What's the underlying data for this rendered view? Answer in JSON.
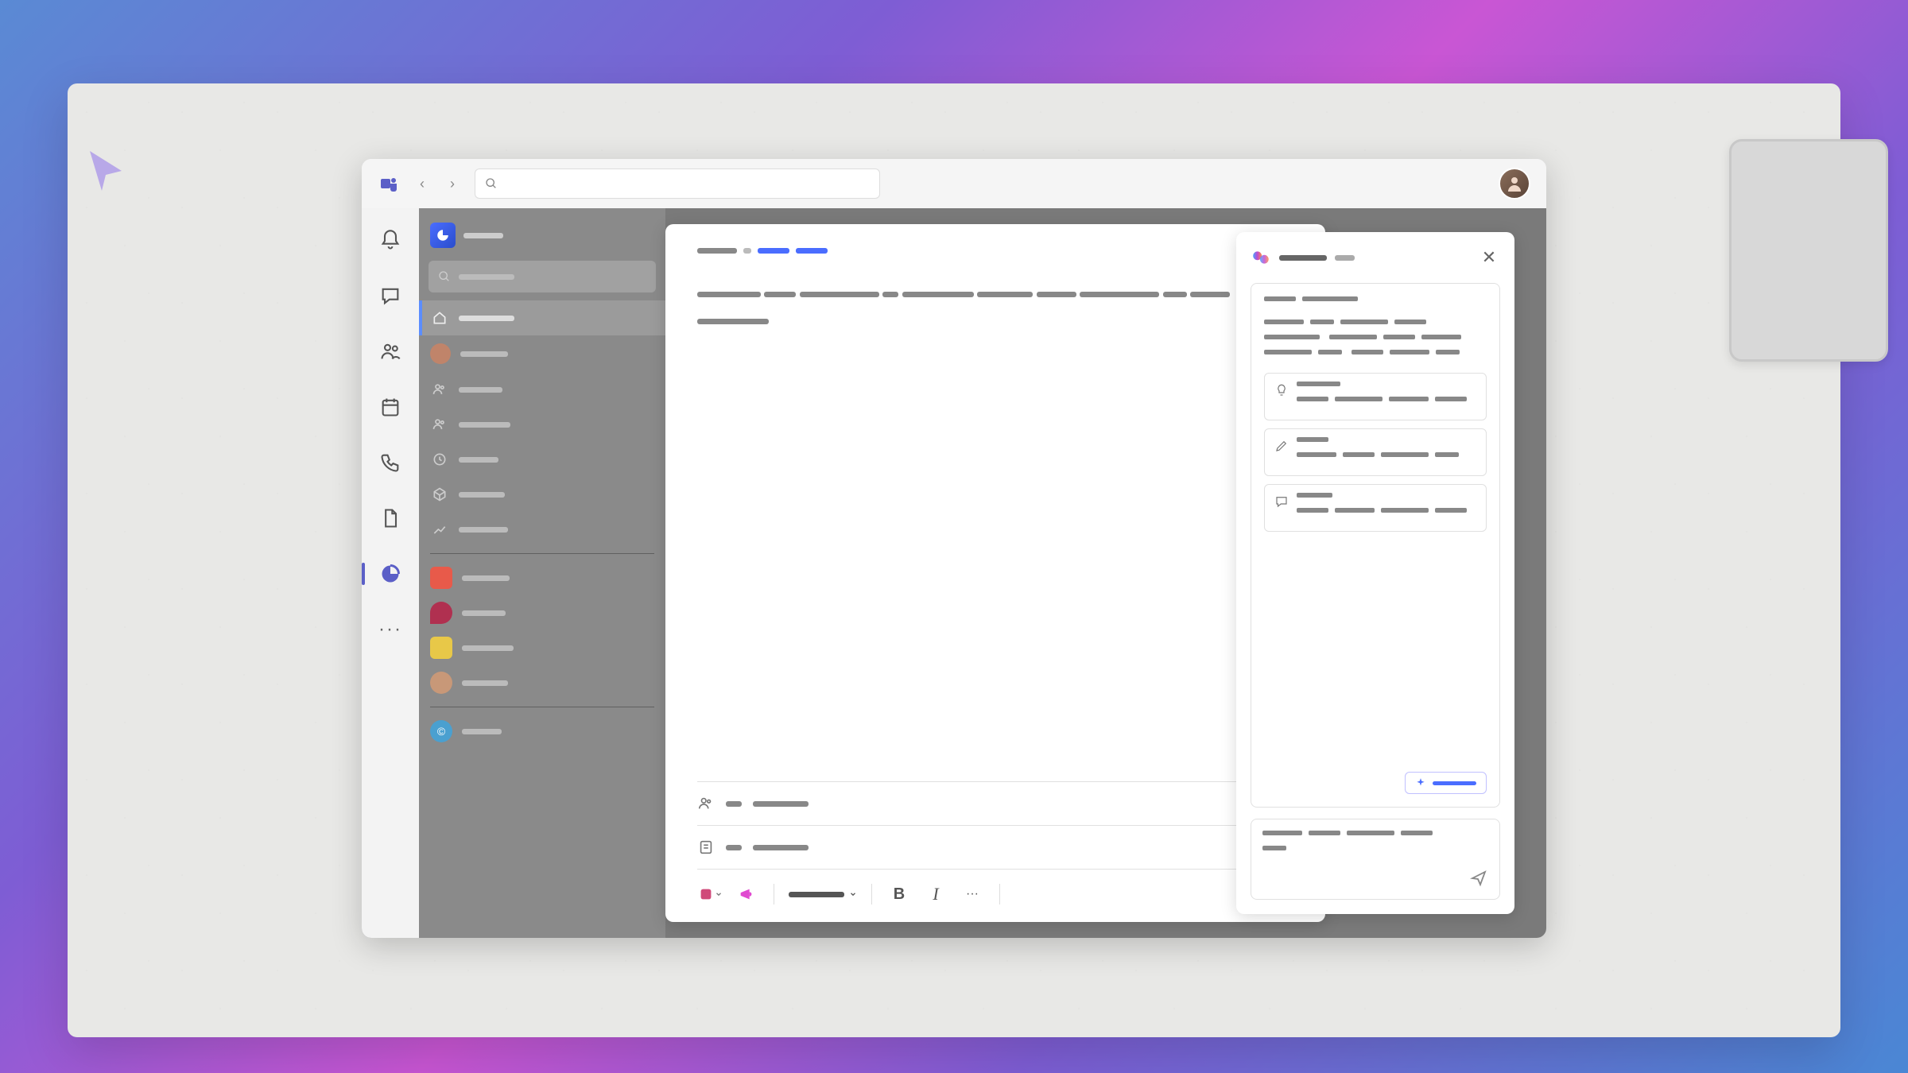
{
  "titlebar": {
    "search_placeholder": "",
    "back_label": "‹",
    "forward_label": "›"
  },
  "rail": {
    "items": [
      {
        "name": "activity",
        "active": false
      },
      {
        "name": "chat",
        "active": false
      },
      {
        "name": "teams",
        "active": false
      },
      {
        "name": "calendar",
        "active": false
      },
      {
        "name": "calls",
        "active": false
      },
      {
        "name": "files",
        "active": false
      },
      {
        "name": "loop",
        "active": true
      }
    ],
    "more_label": "···"
  },
  "workspace": {
    "search_placeholder": "",
    "nav": [
      {
        "icon": "home",
        "active": true
      },
      {
        "icon": "avatar",
        "active": false
      },
      {
        "icon": "people",
        "active": false
      },
      {
        "icon": "people2",
        "active": false
      },
      {
        "icon": "clock",
        "active": false
      },
      {
        "icon": "cube",
        "active": false
      },
      {
        "icon": "trend",
        "active": false
      }
    ],
    "apps_colors": [
      "#e85a4a",
      "#b03050",
      "#e8c848",
      "#c89878"
    ],
    "footer_icon_color": "#4aa0d0"
  },
  "document": {
    "breadcrumb_segments": 3,
    "people_label": "",
    "notes_label": ""
  },
  "toolbar": {
    "bold_label": "B",
    "italic_label": "I",
    "more_label": "···",
    "action_label": ""
  },
  "copilot": {
    "title": "",
    "close_label": "✕",
    "suggestions": [
      {
        "icon": "bulb"
      },
      {
        "icon": "pencil"
      },
      {
        "icon": "chat"
      }
    ],
    "chip_label": "",
    "input_placeholder": "",
    "send_label": ""
  }
}
